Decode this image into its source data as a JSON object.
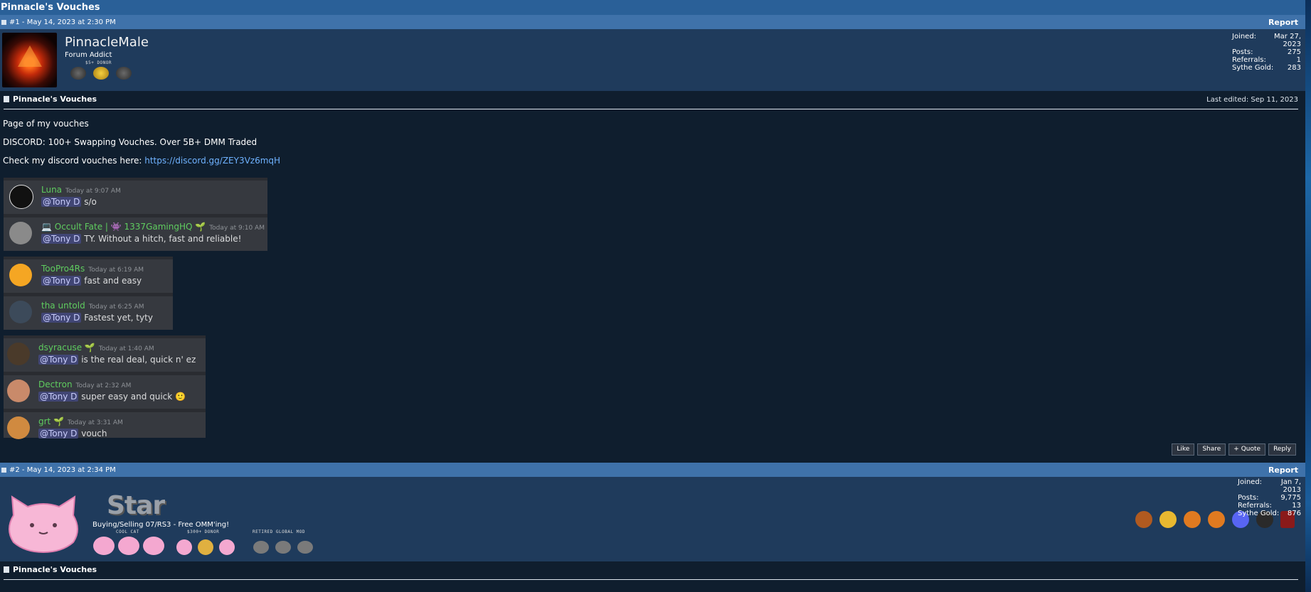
{
  "page": {
    "title": "Pinnacle's Vouches"
  },
  "post1": {
    "header": "#1 - May 14, 2023 at 2:30 PM",
    "report": "Report",
    "username": "PinnacleMale",
    "rank": "Forum Addict",
    "donor_label": "$5+ DONOR",
    "stats": [
      {
        "label": "Joined:",
        "value": "Mar 27, 2023"
      },
      {
        "label": "Posts:",
        "value": "275"
      },
      {
        "label": "Referrals:",
        "value": "1"
      },
      {
        "label": "Sythe Gold:",
        "value": "283"
      }
    ],
    "content_title": "Pinnacle's Vouches",
    "last_edited": "Last edited: Sep 11, 2023",
    "line1": "Page of my vouches",
    "line2": "DISCORD: 100+ Swapping Vouches. Over 5B+ DMM Traded",
    "line3_prefix": "Check my discord vouches here: ",
    "line3_link": "https://discord.gg/ZEY3Vz6mqH",
    "discord_groups": [
      {
        "messages": [
          {
            "name": "Luna",
            "time": "Today at 9:07 AM",
            "mention": "@Tony D",
            "text": " s/o",
            "avatar": "#111111"
          },
          {
            "name": "💻 Occult Fate | 👾 1337GamingHQ 🌱",
            "time": "Today at 9:10 AM",
            "mention": "@Tony D",
            "text": " TY. Without a hitch, fast and reliable!",
            "avatar": "#8a8a8a"
          }
        ]
      },
      {
        "messages": [
          {
            "name": "TooPro4Rs",
            "time": "Today at 6:19 AM",
            "mention": "@Tony D",
            "text": " fast and easy",
            "avatar": "#f5a623"
          },
          {
            "name": "tha untold",
            "time": "Today at 6:25 AM",
            "mention": "@Tony D",
            "text": " Fastest yet, tyty",
            "avatar": "#3c4a5a"
          }
        ]
      },
      {
        "messages": [
          {
            "name": "dsyracuse 🌱",
            "time": "Today at 1:40 AM",
            "mention": "@Tony D",
            "text": " is the real deal, quick n' ez",
            "avatar": "#4a3a2a"
          },
          {
            "name": "Dectron",
            "time": "Today at 2:32 AM",
            "mention": "@Tony D",
            "text": " super easy and quick 🙂",
            "avatar": "#c98a6a"
          },
          {
            "name": "grt 🌱",
            "time": "Today at 3:31 AM",
            "mention": "@Tony D",
            "text": " vouch",
            "avatar": "#d08a40"
          }
        ]
      }
    ],
    "buttons": [
      "Like",
      "Share",
      "+ Quote",
      "Reply"
    ]
  },
  "post2": {
    "header": "#2 - May 14, 2023 at 2:34 PM",
    "report": "Report",
    "username_logo": "Star",
    "signature": "Buying/Selling 07/RS3 - Free OMM'ing!",
    "badge_labels": [
      "COOL CAT",
      "$300+ DONOR",
      "RETIRED GLOBAL MOD"
    ],
    "stats": [
      {
        "label": "Joined:",
        "value": "Jan 7, 2013"
      },
      {
        "label": "Posts:",
        "value": "9,775"
      },
      {
        "label": "Referrals:",
        "value": "13"
      },
      {
        "label": "Sythe Gold:",
        "value": "876"
      }
    ],
    "content_title": "Pinnacle's Vouches"
  },
  "colors": {
    "accent": "#3f72aa",
    "discord_bg": "#36393f",
    "username_green": "#5fcc5f",
    "link": "#6fb2ff"
  }
}
